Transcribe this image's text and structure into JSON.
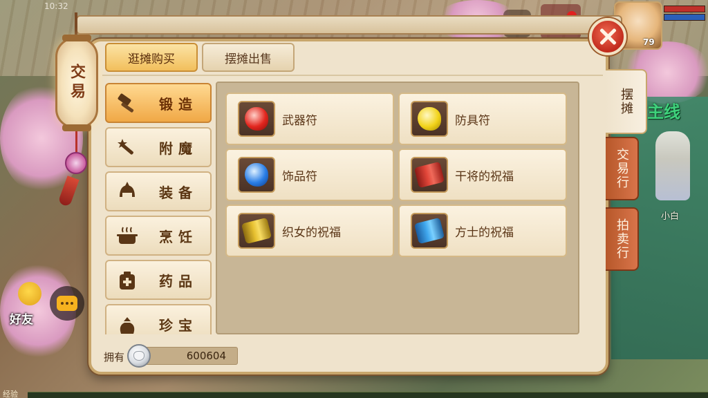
{
  "status": {
    "time": "10:32"
  },
  "hud": {
    "level": "79",
    "quest_label": "主线",
    "npc_name": "小白"
  },
  "lantern": {
    "text": "交易"
  },
  "window": {
    "tabs": [
      {
        "label": "逛摊购买",
        "active": true
      },
      {
        "label": "摆摊出售",
        "active": false
      }
    ],
    "side_tabs": [
      {
        "label": "摆摊",
        "active": true
      },
      {
        "label": "交易行",
        "active": false
      },
      {
        "label": "拍卖行",
        "active": false
      }
    ],
    "categories": [
      {
        "label": "锻造",
        "icon": "hammer-icon",
        "active": true
      },
      {
        "label": "附魔",
        "icon": "magic-wand-icon",
        "active": false
      },
      {
        "label": "装备",
        "icon": "helmet-icon",
        "active": false
      },
      {
        "label": "烹饪",
        "icon": "cooking-pot-icon",
        "active": false
      },
      {
        "label": "药品",
        "icon": "medicine-box-icon",
        "active": false
      },
      {
        "label": "珍宝",
        "icon": "treasure-bag-icon",
        "active": false
      }
    ],
    "items": [
      {
        "label": "武器符",
        "icon": "red-gem-icon"
      },
      {
        "label": "防具符",
        "icon": "yellow-gem-icon"
      },
      {
        "label": "饰品符",
        "icon": "blue-gem-icon"
      },
      {
        "label": "干将的祝福",
        "icon": "red-scroll-icon"
      },
      {
        "label": "织女的祝福",
        "icon": "gold-scroll-icon"
      },
      {
        "label": "方士的祝福",
        "icon": "cyan-scroll-icon"
      }
    ],
    "footer": {
      "owned_label": "拥有",
      "amount": "600604",
      "currency_icon": "silver-coin-icon"
    }
  },
  "bottom": {
    "friend_label": "好友",
    "exp_label": "经验"
  },
  "colors": {
    "accent": "#f2bf5c",
    "side_tab": "#c8643a",
    "close": "#d83a26",
    "quest": "#3fd27c"
  }
}
